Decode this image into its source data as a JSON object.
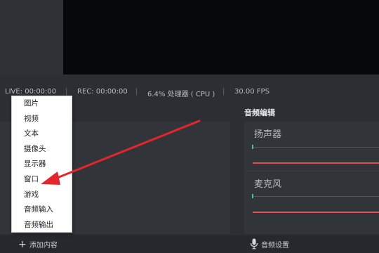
{
  "status": {
    "live": "LIVE: 00:00:00",
    "rec": "REC: 00:00:00",
    "cpu": "6.4% 处理器 ( CPU )",
    "fps": "30.00 FPS",
    "separator": "|"
  },
  "mixer": {
    "title": "音频编辑",
    "channels": [
      {
        "label": "扬声器"
      },
      {
        "label": "麦克风"
      }
    ]
  },
  "context_menu": {
    "items": [
      "图片",
      "视频",
      "文本",
      "摄像头",
      "显示器",
      "窗口",
      "游戏",
      "音频输入",
      "音频输出"
    ]
  },
  "bottom": {
    "add_plus": "+",
    "add_label": "添加内容",
    "audio_settings_label": "音频设置"
  },
  "colors": {
    "accent_arrow": "#e3262b",
    "meter_red": "#e14e55",
    "meter_teal": "#4fbfa0"
  },
  "icons": {
    "add": "plus-icon",
    "audio_settings": "microphone-icon"
  }
}
